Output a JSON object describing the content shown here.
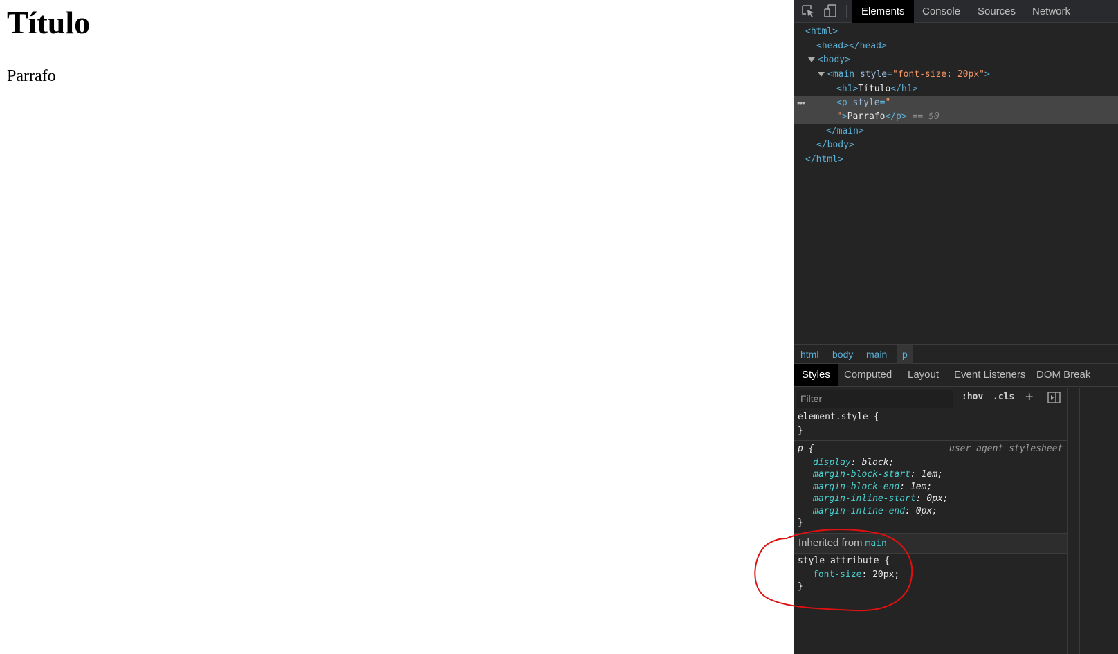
{
  "page": {
    "title": "Título",
    "paragraph": "Parrafo"
  },
  "devtools": {
    "tabs": [
      "Elements",
      "Console",
      "Sources",
      "Network"
    ],
    "dom": {
      "html_open": "<html>",
      "head": "<head></head>",
      "body_open": "<body>",
      "main_tag": "<main",
      "main_attr": "style",
      "main_val": "\"font-size: 20px\"",
      "h1_open": "<h1>",
      "h1_text": "Título",
      "h1_close": "</h1>",
      "p_open": "<p",
      "p_attr": "style",
      "p_val_start": "\"",
      "p_val_end": "\"",
      "p_text": "Parrafo",
      "p_close": "</p>",
      "selected_marker": "== $0",
      "main_close": "</main>",
      "body_close": "</body>",
      "html_close": "</html>"
    },
    "breadcrumbs": [
      "html",
      "body",
      "main",
      "p"
    ],
    "style_tabs": [
      "Styles",
      "Computed",
      "Layout",
      "Event Listeners",
      "DOM Break"
    ],
    "filter": {
      "placeholder": "Filter",
      "hov": ":hov",
      "cls": ".cls",
      "add": "+"
    },
    "rules": {
      "element_style_selector": "element.style {",
      "close_brace": "}",
      "p_selector": "p {",
      "ua_label": "user agent stylesheet",
      "p_decls": [
        {
          "prop": "display",
          "value": "block;"
        },
        {
          "prop": "margin-block-start",
          "value": "1em;"
        },
        {
          "prop": "margin-block-end",
          "value": "1em;"
        },
        {
          "prop": "margin-inline-start",
          "value": "0px;"
        },
        {
          "prop": "margin-inline-end",
          "value": "0px;"
        }
      ],
      "inherited_label": "Inherited from",
      "inherited_source": "main",
      "style_attr_selector": "style attribute {",
      "style_attr_decl": {
        "prop": "font-size",
        "value": "20px;"
      }
    },
    "annotation_color": "#e01010"
  }
}
